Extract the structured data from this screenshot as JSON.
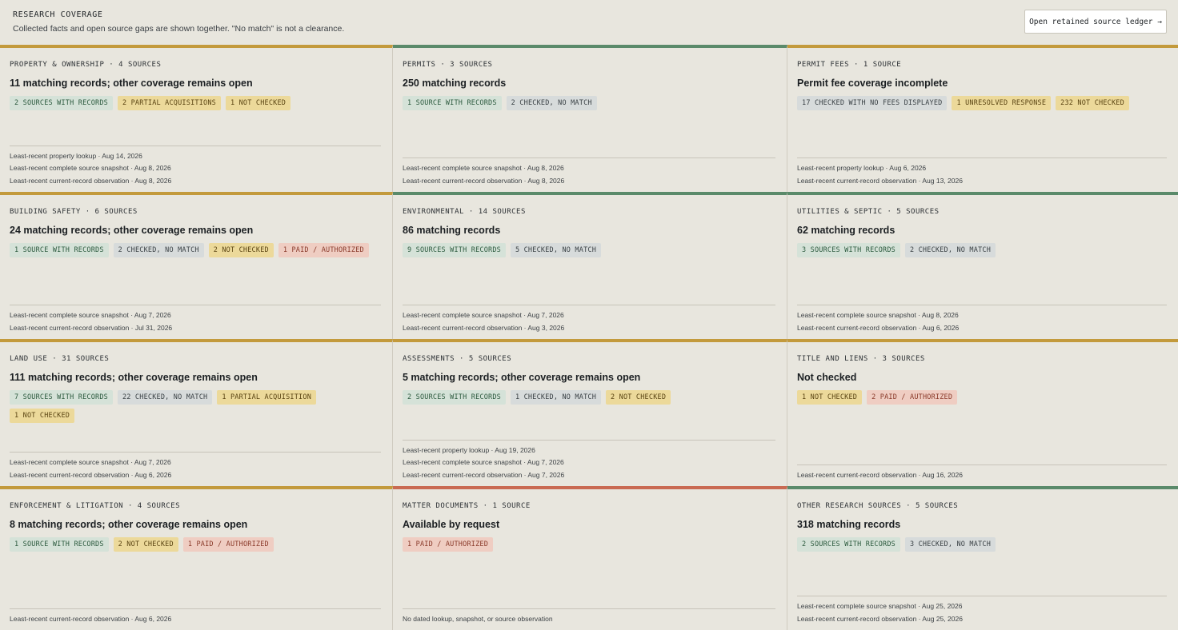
{
  "header": {
    "title": "RESEARCH COVERAGE",
    "subtitle": "Collected facts and open source gaps are shown together. \"No match\" is not a clearance.",
    "ledger_button": "Open retained source ledger →"
  },
  "cards": [
    {
      "heading": "PROPERTY & OWNERSHIP · 4 SOURCES",
      "title": "11 matching records; other coverage remains open",
      "accent": "amber",
      "chips": [
        {
          "label": "2 SOURCES WITH RECORDS",
          "tone": "g"
        },
        {
          "label": "2 PARTIAL ACQUISITIONS",
          "tone": "y"
        },
        {
          "label": "1 NOT CHECKED",
          "tone": "y"
        }
      ],
      "footer": [
        "Least-recent property lookup · Aug 14, 2026",
        "Least-recent complete source snapshot · Aug 8, 2026",
        "Least-recent current-record observation · Aug 8, 2026"
      ]
    },
    {
      "heading": "PERMITS · 3 SOURCES",
      "title": "250 matching records",
      "accent": "green",
      "chips": [
        {
          "label": "1 SOURCE WITH RECORDS",
          "tone": "g"
        },
        {
          "label": "2 CHECKED, NO MATCH",
          "tone": "s"
        }
      ],
      "footer": [
        "Least-recent complete source snapshot · Aug 8, 2026",
        "Least-recent current-record observation · Aug 8, 2026"
      ]
    },
    {
      "heading": "PERMIT FEES · 1 SOURCE",
      "title": "Permit fee coverage incomplete",
      "accent": "amber",
      "chips": [
        {
          "label": "17 CHECKED WITH NO FEES DISPLAYED",
          "tone": "s"
        },
        {
          "label": "1 UNRESOLVED RESPONSE",
          "tone": "y"
        },
        {
          "label": "232 NOT CHECKED",
          "tone": "y"
        }
      ],
      "footer": [
        "Least-recent property lookup · Aug 6, 2026",
        "Least-recent current-record observation · Aug 13, 2026"
      ]
    },
    {
      "heading": "BUILDING SAFETY · 6 SOURCES",
      "title": "24 matching records; other coverage remains open",
      "accent": "amber",
      "chips": [
        {
          "label": "1 SOURCE WITH RECORDS",
          "tone": "g"
        },
        {
          "label": "2 CHECKED, NO MATCH",
          "tone": "s"
        },
        {
          "label": "2 NOT CHECKED",
          "tone": "y"
        },
        {
          "label": "1 PAID / AUTHORIZED",
          "tone": "r"
        }
      ],
      "footer": [
        "Least-recent complete source snapshot · Aug 7, 2026",
        "Least-recent current-record observation · Jul 31, 2026"
      ]
    },
    {
      "heading": "ENVIRONMENTAL · 14 SOURCES",
      "title": "86 matching records",
      "accent": "green",
      "chips": [
        {
          "label": "9 SOURCES WITH RECORDS",
          "tone": "g"
        },
        {
          "label": "5 CHECKED, NO MATCH",
          "tone": "s"
        }
      ],
      "footer": [
        "Least-recent complete source snapshot · Aug 7, 2026",
        "Least-recent current-record observation · Aug 3, 2026"
      ]
    },
    {
      "heading": "UTILITIES & SEPTIC · 5 SOURCES",
      "title": "62 matching records",
      "accent": "green",
      "chips": [
        {
          "label": "3 SOURCES WITH RECORDS",
          "tone": "g"
        },
        {
          "label": "2 CHECKED, NO MATCH",
          "tone": "s"
        }
      ],
      "footer": [
        "Least-recent complete source snapshot · Aug 8, 2026",
        "Least-recent current-record observation · Aug 6, 2026"
      ]
    },
    {
      "heading": "LAND USE · 31 SOURCES",
      "title": "111 matching records; other coverage remains open",
      "accent": "amber",
      "chips": [
        {
          "label": "7 SOURCES WITH RECORDS",
          "tone": "g"
        },
        {
          "label": "22 CHECKED, NO MATCH",
          "tone": "s"
        },
        {
          "label": "1 PARTIAL ACQUISITION",
          "tone": "y"
        },
        {
          "label": "1 NOT CHECKED",
          "tone": "y"
        }
      ],
      "footer": [
        "Least-recent complete source snapshot · Aug 7, 2026",
        "Least-recent current-record observation · Aug 6, 2026"
      ]
    },
    {
      "heading": "ASSESSMENTS · 5 SOURCES",
      "title": "5 matching records; other coverage remains open",
      "accent": "amber",
      "chips": [
        {
          "label": "2 SOURCES WITH RECORDS",
          "tone": "g"
        },
        {
          "label": "1 CHECKED, NO MATCH",
          "tone": "s"
        },
        {
          "label": "2 NOT CHECKED",
          "tone": "y"
        }
      ],
      "footer": [
        "Least-recent property lookup · Aug 19, 2026",
        "Least-recent complete source snapshot · Aug 7, 2026",
        "Least-recent current-record observation · Aug 7, 2026"
      ]
    },
    {
      "heading": "TITLE AND LIENS · 3 SOURCES",
      "title": "Not checked",
      "accent": "amber",
      "chips": [
        {
          "label": "1 NOT CHECKED",
          "tone": "y"
        },
        {
          "label": "2 PAID / AUTHORIZED",
          "tone": "r"
        }
      ],
      "footer": [
        "Least-recent current-record observation · Aug 16, 2026"
      ]
    },
    {
      "heading": "ENFORCEMENT & LITIGATION · 4 SOURCES",
      "title": "8 matching records; other coverage remains open",
      "accent": "amber",
      "chips": [
        {
          "label": "1 SOURCE WITH RECORDS",
          "tone": "g"
        },
        {
          "label": "2 NOT CHECKED",
          "tone": "y"
        },
        {
          "label": "1 PAID / AUTHORIZED",
          "tone": "r"
        }
      ],
      "footer": [
        "Least-recent current-record observation · Aug 6, 2026"
      ]
    },
    {
      "heading": "MATTER DOCUMENTS · 1 SOURCE",
      "title": "Available by request",
      "accent": "red",
      "chips": [
        {
          "label": "1 PAID / AUTHORIZED",
          "tone": "r"
        }
      ],
      "footer": [
        "No dated lookup, snapshot, or source observation"
      ]
    },
    {
      "heading": "OTHER RESEARCH SOURCES · 5 SOURCES",
      "title": "318 matching records",
      "accent": "green",
      "chips": [
        {
          "label": "2 SOURCES WITH RECORDS",
          "tone": "g"
        },
        {
          "label": "3 CHECKED, NO MATCH",
          "tone": "s"
        }
      ],
      "footer": [
        "Least-recent complete source snapshot · Aug 25, 2026",
        "Least-recent current-record observation · Aug 25, 2026"
      ]
    }
  ]
}
